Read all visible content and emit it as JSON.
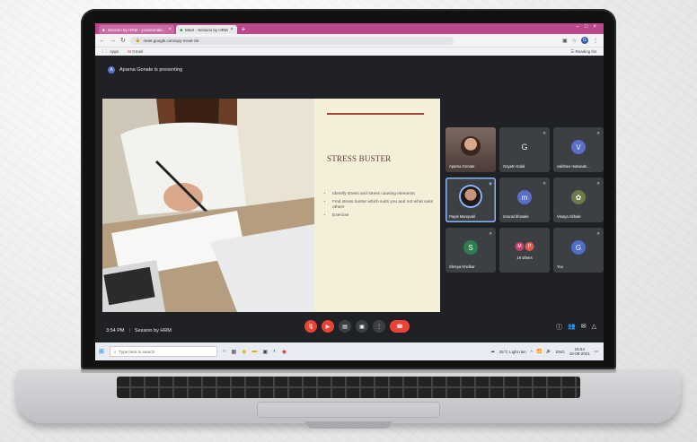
{
  "browser": {
    "tabs": [
      {
        "label": "Session by HRM - yourdomaib..."
      },
      {
        "label": "Meet - Session by HRM"
      }
    ],
    "url": "meet.google.com/xpy-mnwl-cle",
    "bookmarks": [
      "Apps",
      "Gmail"
    ],
    "reading_list": "Reading list",
    "profile_initial": "G"
  },
  "meet": {
    "presenter_initial": "A",
    "presenting_text": "Aparna Gonate is presenting",
    "meeting_time": "3:54 PM",
    "meeting_name": "Session by HRM",
    "slide": {
      "title": "STRESS BUSTER",
      "bullets": [
        "Identify stress and stress causing elements",
        "Find stress buster which suits you and not what suits others",
        "Exercise"
      ]
    },
    "participants": [
      {
        "name": "Aparna Gonate",
        "type": "video"
      },
      {
        "name": "Gayatri Kalal",
        "initial": "G",
        "color": "#3c4043"
      },
      {
        "name": "vaibhavi malwade...",
        "initial": "V",
        "color": "#5b6fc9"
      },
      {
        "name": "Payal Marepatil",
        "type": "avatar"
      },
      {
        "name": "mrunal bhosale",
        "initial": "m",
        "color": "#5b6fc9"
      },
      {
        "name": "Vinaya Abhale",
        "initial": "",
        "color": "#3c4043"
      },
      {
        "name": "Shreya Khelkar",
        "initial": "S",
        "color": "#2e7d4f"
      },
      {
        "name": "19 others",
        "initials": [
          "M",
          "P"
        ],
        "colors": [
          "#c0446f",
          "#e35b4c"
        ]
      },
      {
        "name": "You",
        "initial": "G",
        "color": "#4f6ec9"
      }
    ]
  },
  "taskbar": {
    "search_placeholder": "Type here to search",
    "weather": "25°C Light rain",
    "language": "ENG",
    "time": "15:54",
    "date": "16-08-2021"
  },
  "colors": {
    "tab_bar": "#b9498b",
    "end_call": "#ea4335",
    "meet_bg": "#202124",
    "slide_bg": "#f3efd9"
  }
}
